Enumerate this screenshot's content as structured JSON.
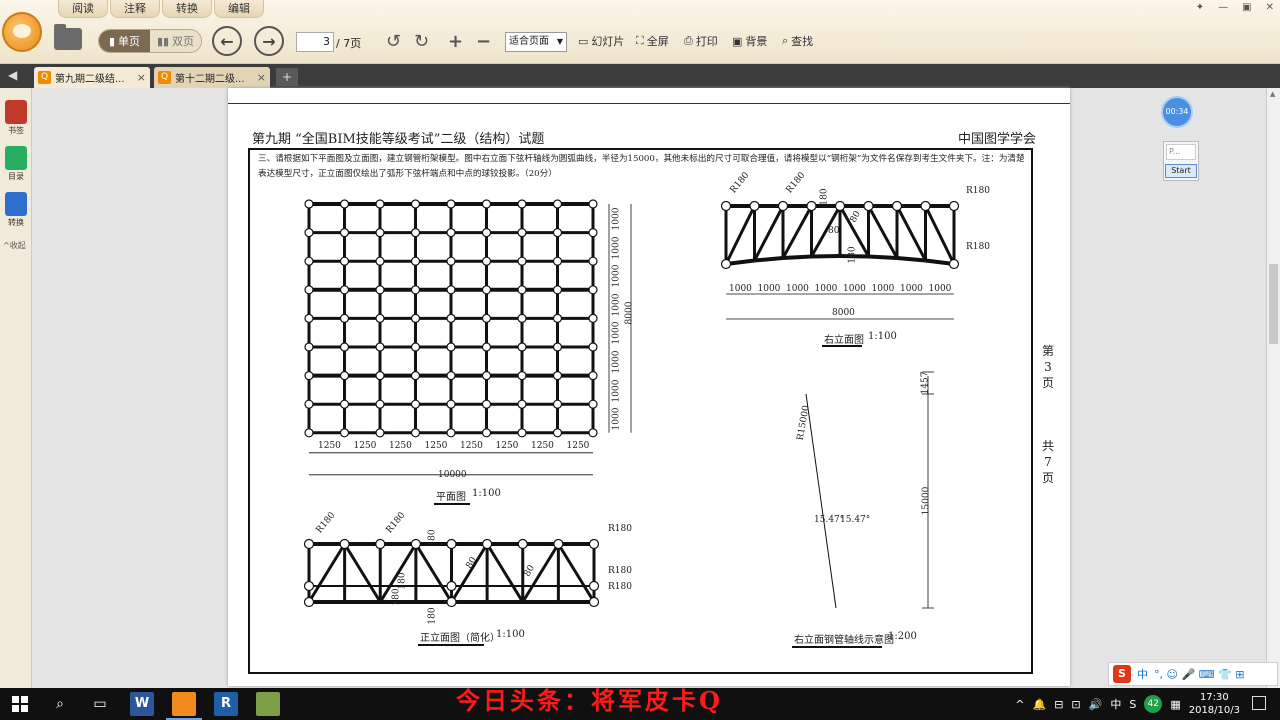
{
  "app": {
    "menu_tabs": [
      "阅读",
      "注释",
      "转换",
      "编辑"
    ],
    "window_controls": [
      "✦",
      "—",
      "▣",
      "✕"
    ]
  },
  "toolbar": {
    "single_page": "单页",
    "double_page": "双页",
    "current_page": "3",
    "page_total": "/ 7页",
    "zoom": "适合页面",
    "slideshow": "幻灯片",
    "fullscreen": "全屏",
    "print": "打印",
    "background": "背景",
    "find": "查找"
  },
  "tabs": [
    {
      "label": "第九期二级结...",
      "close": "×"
    },
    {
      "label": "第十二期二级...",
      "close": "×"
    }
  ],
  "tab_add": "+",
  "sidebar": {
    "items": [
      {
        "label": "书签",
        "color": "#c0392b"
      },
      {
        "label": "目录",
        "color": "#27ae60"
      },
      {
        "label": "转换",
        "color": "#2f6ecf"
      }
    ],
    "collapse": "^收起"
  },
  "document": {
    "title": "第九期 “全国BIM技能等级考试”二级（结构）试题",
    "org": "中国图学学会",
    "question": "三、请根据如下平面图及立面图，建立钢管桁架模型。图中右立面下弦杆轴线为圆弧曲线，半径为15000，其他未标出的尺寸可取合理值，请将模型以“钢桁架”为文件名保存到考生文件夹下。注：为清楚表达模型尺寸，正立面图仅绘出了弧形下弦杆端点和中点的球铰投影。（20分）",
    "page_label": [
      "第",
      "3",
      "页"
    ],
    "total_label": [
      "共",
      "7",
      "页"
    ],
    "plan": {
      "caption": "平面图",
      "scale": "1:100",
      "x_dims": [
        "1250",
        "1250",
        "1250",
        "1250",
        "1250",
        "1250",
        "1250",
        "1250"
      ],
      "x_total": "10000",
      "y_dims": [
        "1000",
        "1000",
        "1000",
        "1000",
        "1000",
        "1000",
        "1000",
        "1000"
      ],
      "y_total": "8000"
    },
    "front": {
      "caption": "正立面图（简化）",
      "scale": "1:100",
      "labels": [
        "R180",
        "R180",
        "R180",
        "R180",
        "R180",
        "180",
        "80",
        "80",
        "180",
        "180",
        "180"
      ]
    },
    "right": {
      "caption": "右立面图",
      "scale": "1:100",
      "labels": [
        "R180",
        "R180",
        "R180",
        "R180",
        "180",
        "80",
        "80",
        "180"
      ],
      "dims": [
        "1000",
        "1000",
        "1000",
        "1000",
        "1000",
        "1000",
        "1000",
        "1000"
      ],
      "total": "8000"
    },
    "axis": {
      "caption": "右立面钢管轴线示意图",
      "scale": "1:200",
      "radius": "R15000",
      "angle_left": "15.47°",
      "angle_right": "15.47°",
      "sag": "1457",
      "height": "15000"
    }
  },
  "widgets": {
    "timer": "00:34",
    "rec_field": "P...",
    "rec_button": "Start"
  },
  "ime": {
    "logo": "S",
    "lang": "中",
    "extras": "°, ☺ 🎤 ⌨ 👕 ⊞"
  },
  "watermark": "今日头条：将军皮卡Q",
  "taskbar": {
    "apps": [
      {
        "label": "W",
        "color": "#2b579a"
      },
      {
        "label": "",
        "color": "#f28b1e"
      },
      {
        "label": "R",
        "color": "#1f5fa8"
      },
      {
        "label": "",
        "color": "#7c9f48"
      }
    ],
    "tray": [
      "^",
      "🔔",
      "⊟",
      "⊡",
      "🔊",
      "中",
      "S"
    ],
    "badge": "42",
    "time": "17:30",
    "date": "2018/10/3"
  }
}
